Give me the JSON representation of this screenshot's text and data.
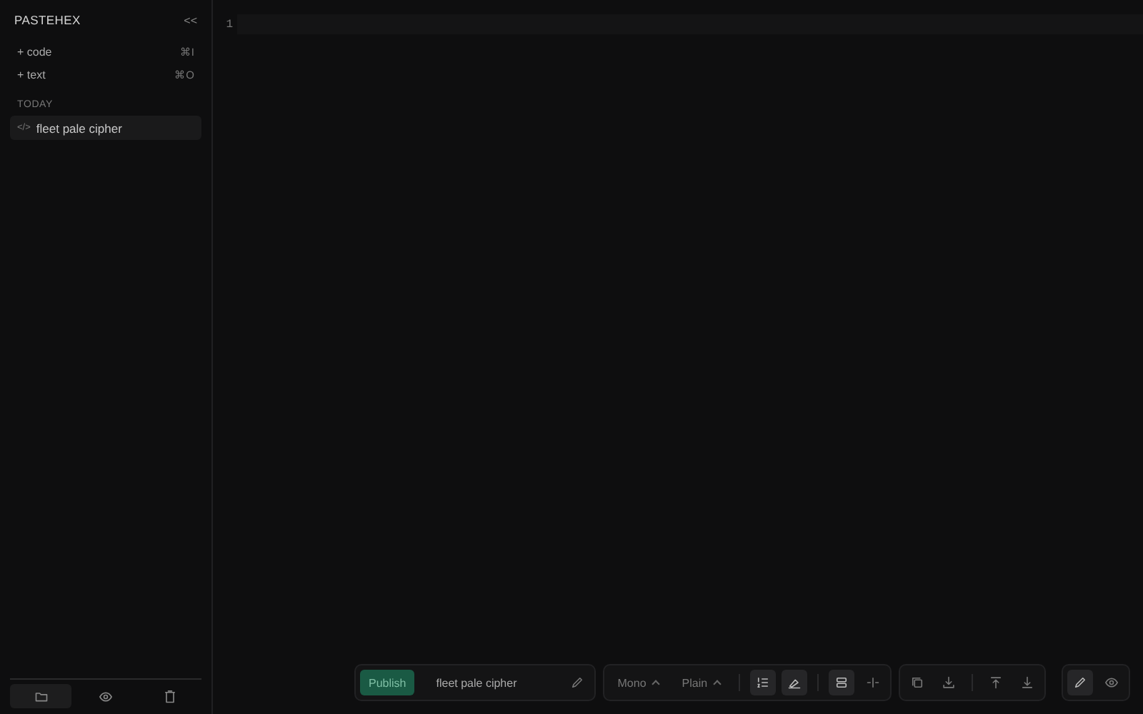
{
  "sidebar": {
    "title": "PASTEHEX",
    "collapse": "<<",
    "new_items": [
      {
        "label": "+ code",
        "shortcut": "⌘I"
      },
      {
        "label": "+ text",
        "shortcut": "⌘O"
      }
    ],
    "section": "TODAY",
    "items": [
      {
        "icon": "</>",
        "label": "fleet pale cipher",
        "selected": true
      }
    ],
    "footer": [
      {
        "kind": "folder",
        "selected": true
      },
      {
        "kind": "eye",
        "selected": false
      },
      {
        "kind": "trash",
        "selected": false
      }
    ]
  },
  "editor": {
    "lines": [
      "1"
    ]
  },
  "toolbar": {
    "publish": "Publish",
    "name": "fleet pale cipher",
    "selects": [
      "Mono",
      "Plain"
    ],
    "toggles": [
      {
        "kind": "numbers",
        "on": true
      },
      {
        "kind": "highlight",
        "on": true
      },
      {
        "kind": "wrap",
        "on": true
      },
      {
        "kind": "split",
        "on": false
      }
    ],
    "actions": [
      {
        "kind": "copy"
      },
      {
        "kind": "download"
      },
      {
        "kind": "top"
      },
      {
        "kind": "bottom"
      }
    ],
    "modes": [
      {
        "kind": "edit",
        "selected": true
      },
      {
        "kind": "eye",
        "selected": false
      }
    ]
  }
}
